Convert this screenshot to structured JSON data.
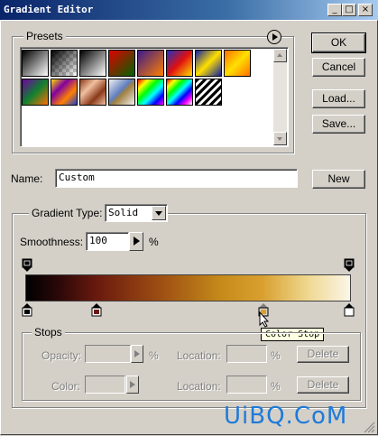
{
  "window": {
    "title": "Gradient Editor",
    "controls": [
      "_",
      "□",
      "×"
    ]
  },
  "presets": {
    "label": "Presets",
    "menu_icon": "arrow-circle-icon",
    "swatches": [
      "Foreground to Background",
      "Foreground to Transparent",
      "Black, White",
      "Red, Green",
      "Violet, Orange",
      "Blue, Red, Yellow",
      "Blue, Yellow, Blue",
      "Orange, Yellow, Orange",
      "Violet, Green, Orange",
      "Yellow, Violet, Orange, Blue",
      "Copper",
      "Chrome",
      "Spectrum",
      "Transparent Rainbow",
      "Transparent Stripes"
    ]
  },
  "buttons": {
    "ok": "OK",
    "cancel": "Cancel",
    "load": "Load...",
    "save": "Save...",
    "new": "New"
  },
  "name": {
    "label": "Name:",
    "value": "Custom"
  },
  "gradient": {
    "type_label": "Gradient Type:",
    "type_value": "Solid",
    "smoothness_label": "Smoothness:",
    "smoothness_value": "100",
    "smoothness_unit": "%",
    "color_stop_positions": [
      0.0,
      0.22,
      0.73,
      1.0
    ],
    "tooltip": "Color Stop"
  },
  "stops": {
    "label": "Stops",
    "opacity_label": "Opacity:",
    "opacity_unit": "%",
    "color_label": "Color:",
    "location_label": "Location:",
    "location_unit": "%",
    "delete_label": "Delete"
  },
  "watermark": "UiBQ.CoM"
}
